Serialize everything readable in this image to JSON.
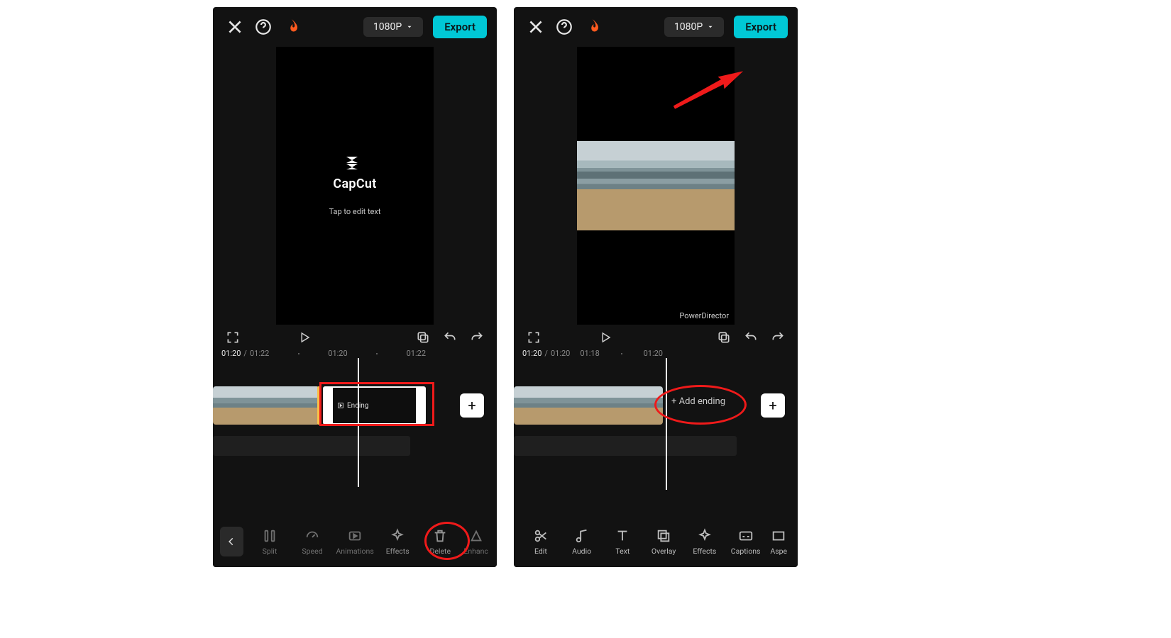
{
  "shared": {
    "resolution_label": "1080P",
    "export_label": "Export",
    "add_ending_label": "+ Add ending",
    "ending_clip_label": "Ending"
  },
  "left": {
    "preview": {
      "brand_word": "CapCut",
      "subtext": "Tap to edit text"
    },
    "timecodes": {
      "current": "01:20",
      "total": "01:22",
      "mid": "01:20",
      "right": "01:22"
    },
    "toolbar": {
      "items": [
        {
          "id": "split",
          "label": "Split"
        },
        {
          "id": "speed",
          "label": "Speed"
        },
        {
          "id": "animations",
          "label": "Animations"
        },
        {
          "id": "effects",
          "label": "Effects"
        },
        {
          "id": "delete",
          "label": "Delete"
        },
        {
          "id": "enhance",
          "label": "Enhanc"
        }
      ]
    }
  },
  "right": {
    "watermark": "PowerDirector",
    "timecodes": {
      "current": "01:20",
      "total": "01:20",
      "mid": "01:18",
      "right": "01:20"
    },
    "toolbar": {
      "items": [
        {
          "id": "edit",
          "label": "Edit"
        },
        {
          "id": "audio",
          "label": "Audio"
        },
        {
          "id": "text",
          "label": "Text"
        },
        {
          "id": "overlay",
          "label": "Overlay"
        },
        {
          "id": "effects",
          "label": "Effects"
        },
        {
          "id": "captions",
          "label": "Captions"
        },
        {
          "id": "aspect",
          "label": "Aspe"
        }
      ]
    }
  }
}
